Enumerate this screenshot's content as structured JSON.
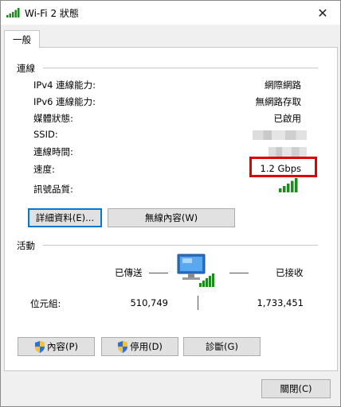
{
  "window": {
    "title": "Wi-Fi 2 狀態",
    "close_label": "✕"
  },
  "tab": {
    "label": "一般"
  },
  "connection": {
    "section_label": "連線",
    "rows": [
      {
        "label": "IPv4 連線能力:",
        "value": "網際網路"
      },
      {
        "label": "IPv6 連線能力:",
        "value": "無網路存取"
      },
      {
        "label": "媒體狀態:",
        "value": "已啟用"
      },
      {
        "label": "SSID:",
        "value": ""
      },
      {
        "label": "連線時間:",
        "value": ""
      },
      {
        "label": "速度:",
        "value": "1.2 Gbps"
      },
      {
        "label": "訊號品質:",
        "value": ""
      }
    ],
    "details_button": "詳細資料(E)...",
    "wireless_button": "無線內容(W)"
  },
  "activity": {
    "section_label": "活動",
    "sent_label": "已傳送",
    "received_label": "已接收",
    "bytes_label": "位元組:",
    "bytes_sent": "510,749",
    "bytes_received": "1,733,451"
  },
  "buttons": {
    "properties": "內容(P)",
    "disable": "停用(D)",
    "diagnose": "診斷(G)",
    "close": "關閉(C)"
  },
  "colors": {
    "highlight": "#e00000",
    "signal_green": "#1f8a1f",
    "focus_blue": "#0078d7"
  }
}
